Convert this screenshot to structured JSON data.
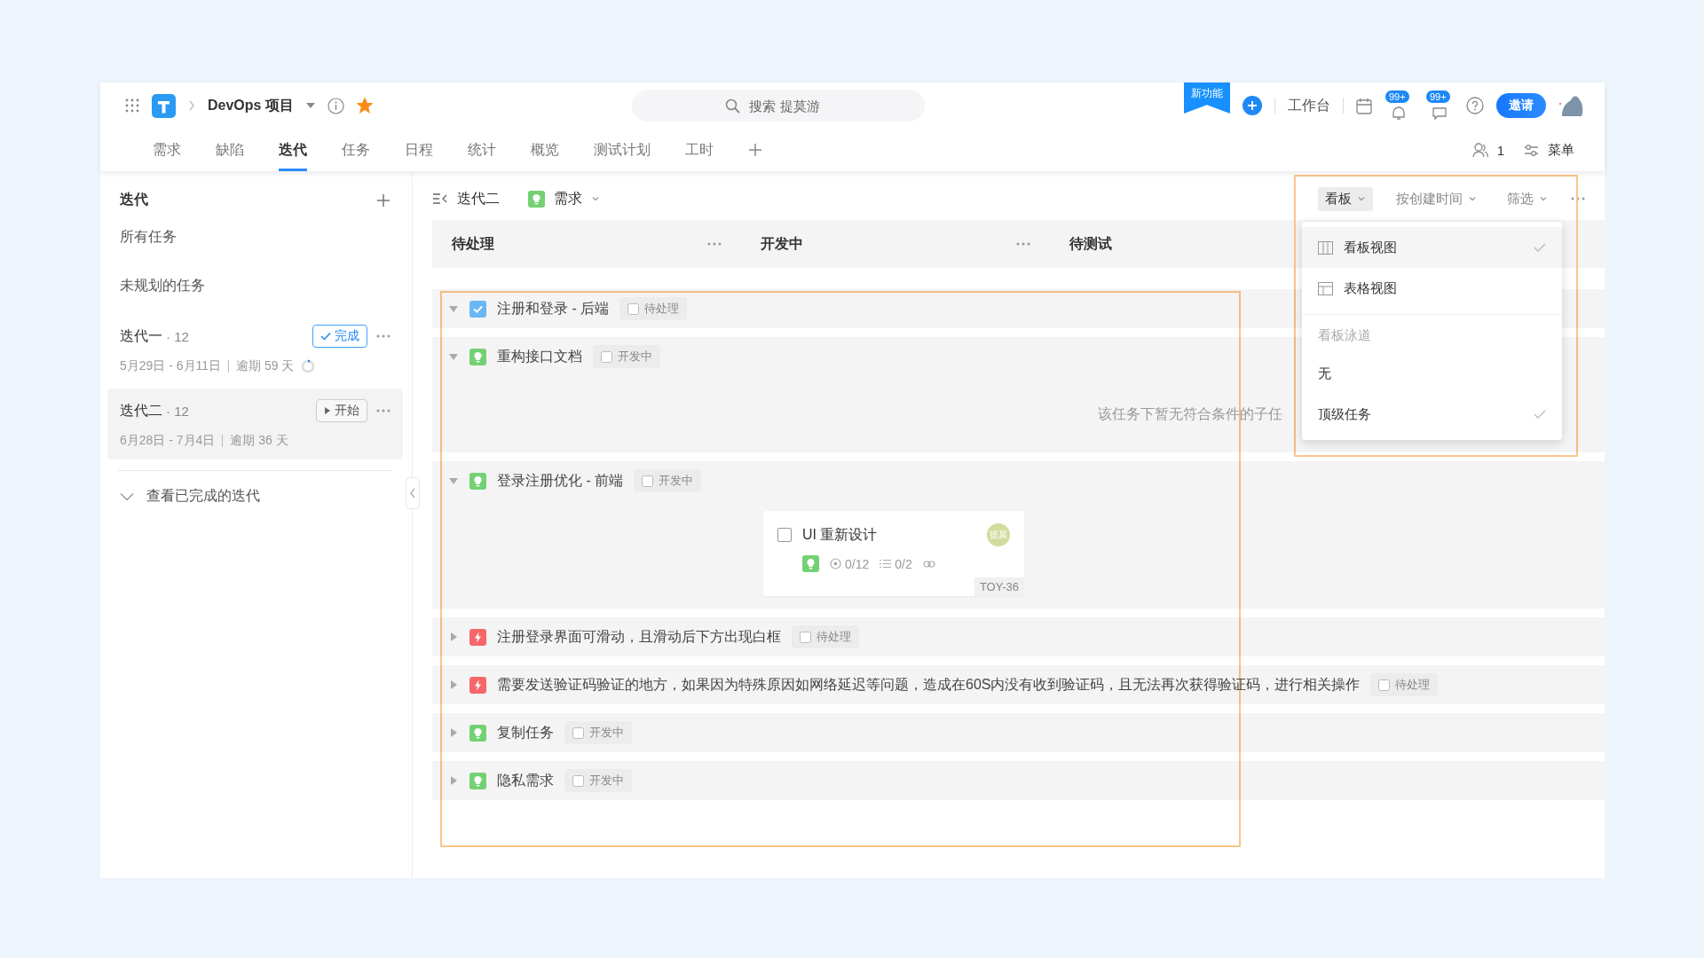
{
  "header": {
    "project": "DevOps 项目",
    "starred": true,
    "search": {
      "placeholder": "搜索 提莫游"
    },
    "new_badge": "新功能",
    "workbench": "工作台",
    "notifications": [
      "99+",
      "99+"
    ],
    "invite": "邀请"
  },
  "tabs": [
    {
      "label": "需求",
      "selected": false
    },
    {
      "label": "缺陷",
      "selected": false
    },
    {
      "label": "迭代",
      "selected": true
    },
    {
      "label": "任务",
      "selected": false
    },
    {
      "label": "日程",
      "selected": false
    },
    {
      "label": "统计",
      "selected": false
    },
    {
      "label": "概览",
      "selected": false
    },
    {
      "label": "测试计划",
      "selected": false
    },
    {
      "label": "工时",
      "selected": false
    }
  ],
  "tab_actions": {
    "members": "1",
    "menu": "菜单"
  },
  "sidebar": {
    "title": "迭代",
    "items": [
      "所有任务",
      "未规划的任务"
    ],
    "iterations": [
      {
        "name": "迭代一",
        "count": "· 12",
        "kind": "done",
        "action": "完成",
        "dates": "5月29日 - 6月11日",
        "overdue": "逾期 59 天",
        "selected": false
      },
      {
        "name": "迭代二",
        "count": "· 12",
        "kind": "start",
        "action": "开始",
        "dates": "6月28日 - 7月4日",
        "overdue": "逾期 36 天",
        "selected": true
      }
    ],
    "completed_link": "查看已完成的迭代"
  },
  "board": {
    "iteration": "迭代二",
    "type_filter": "需求",
    "view": "看板",
    "sort": "按创建时间",
    "filter": "筛选",
    "columns": [
      "待处理",
      "开发中",
      "待测试"
    ],
    "lanes": [
      {
        "title": "注册和登录 - 后端",
        "kind": "task",
        "status": "待处理",
        "expanded": true
      },
      {
        "title": "重构接口文档",
        "kind": "story",
        "status": "开发中",
        "expanded": true,
        "empty_message": "该任务下暂无符合条件的子任"
      },
      {
        "title": "登录注册优化 - 前端",
        "kind": "story",
        "status": "开发中",
        "expanded": true,
        "cards": [
          {
            "title": "UI 重新设计",
            "checked": false,
            "assignee": "提莫",
            "kind": "story",
            "progress": "0/12",
            "subtasks": "0/2",
            "key": "TOY-36"
          }
        ]
      },
      {
        "title": "注册登录界面可滑动，且滑动后下方出现白框",
        "kind": "bug",
        "status": "待处理",
        "expanded": false
      },
      {
        "title": "需要发送验证码验证的地方，如果因为特殊原因如网络延迟等问题，造成在60S内没有收到验证码，且无法再次获得验证码，进行相关操作",
        "kind": "bug",
        "status": "待处理",
        "expanded": false
      },
      {
        "title": "复制任务",
        "kind": "story",
        "status": "开发中",
        "expanded": false
      },
      {
        "title": "隐私需求",
        "kind": "story",
        "status": "开发中",
        "expanded": false
      }
    ]
  },
  "view_menu": {
    "views": [
      {
        "label": "看板视图",
        "kind": "board",
        "selected": true
      },
      {
        "label": "表格视图",
        "kind": "table",
        "selected": false
      }
    ],
    "section": "看板泳道",
    "swimlanes": [
      {
        "label": "无",
        "selected": false
      },
      {
        "label": "顶级任务",
        "selected": true
      }
    ]
  }
}
